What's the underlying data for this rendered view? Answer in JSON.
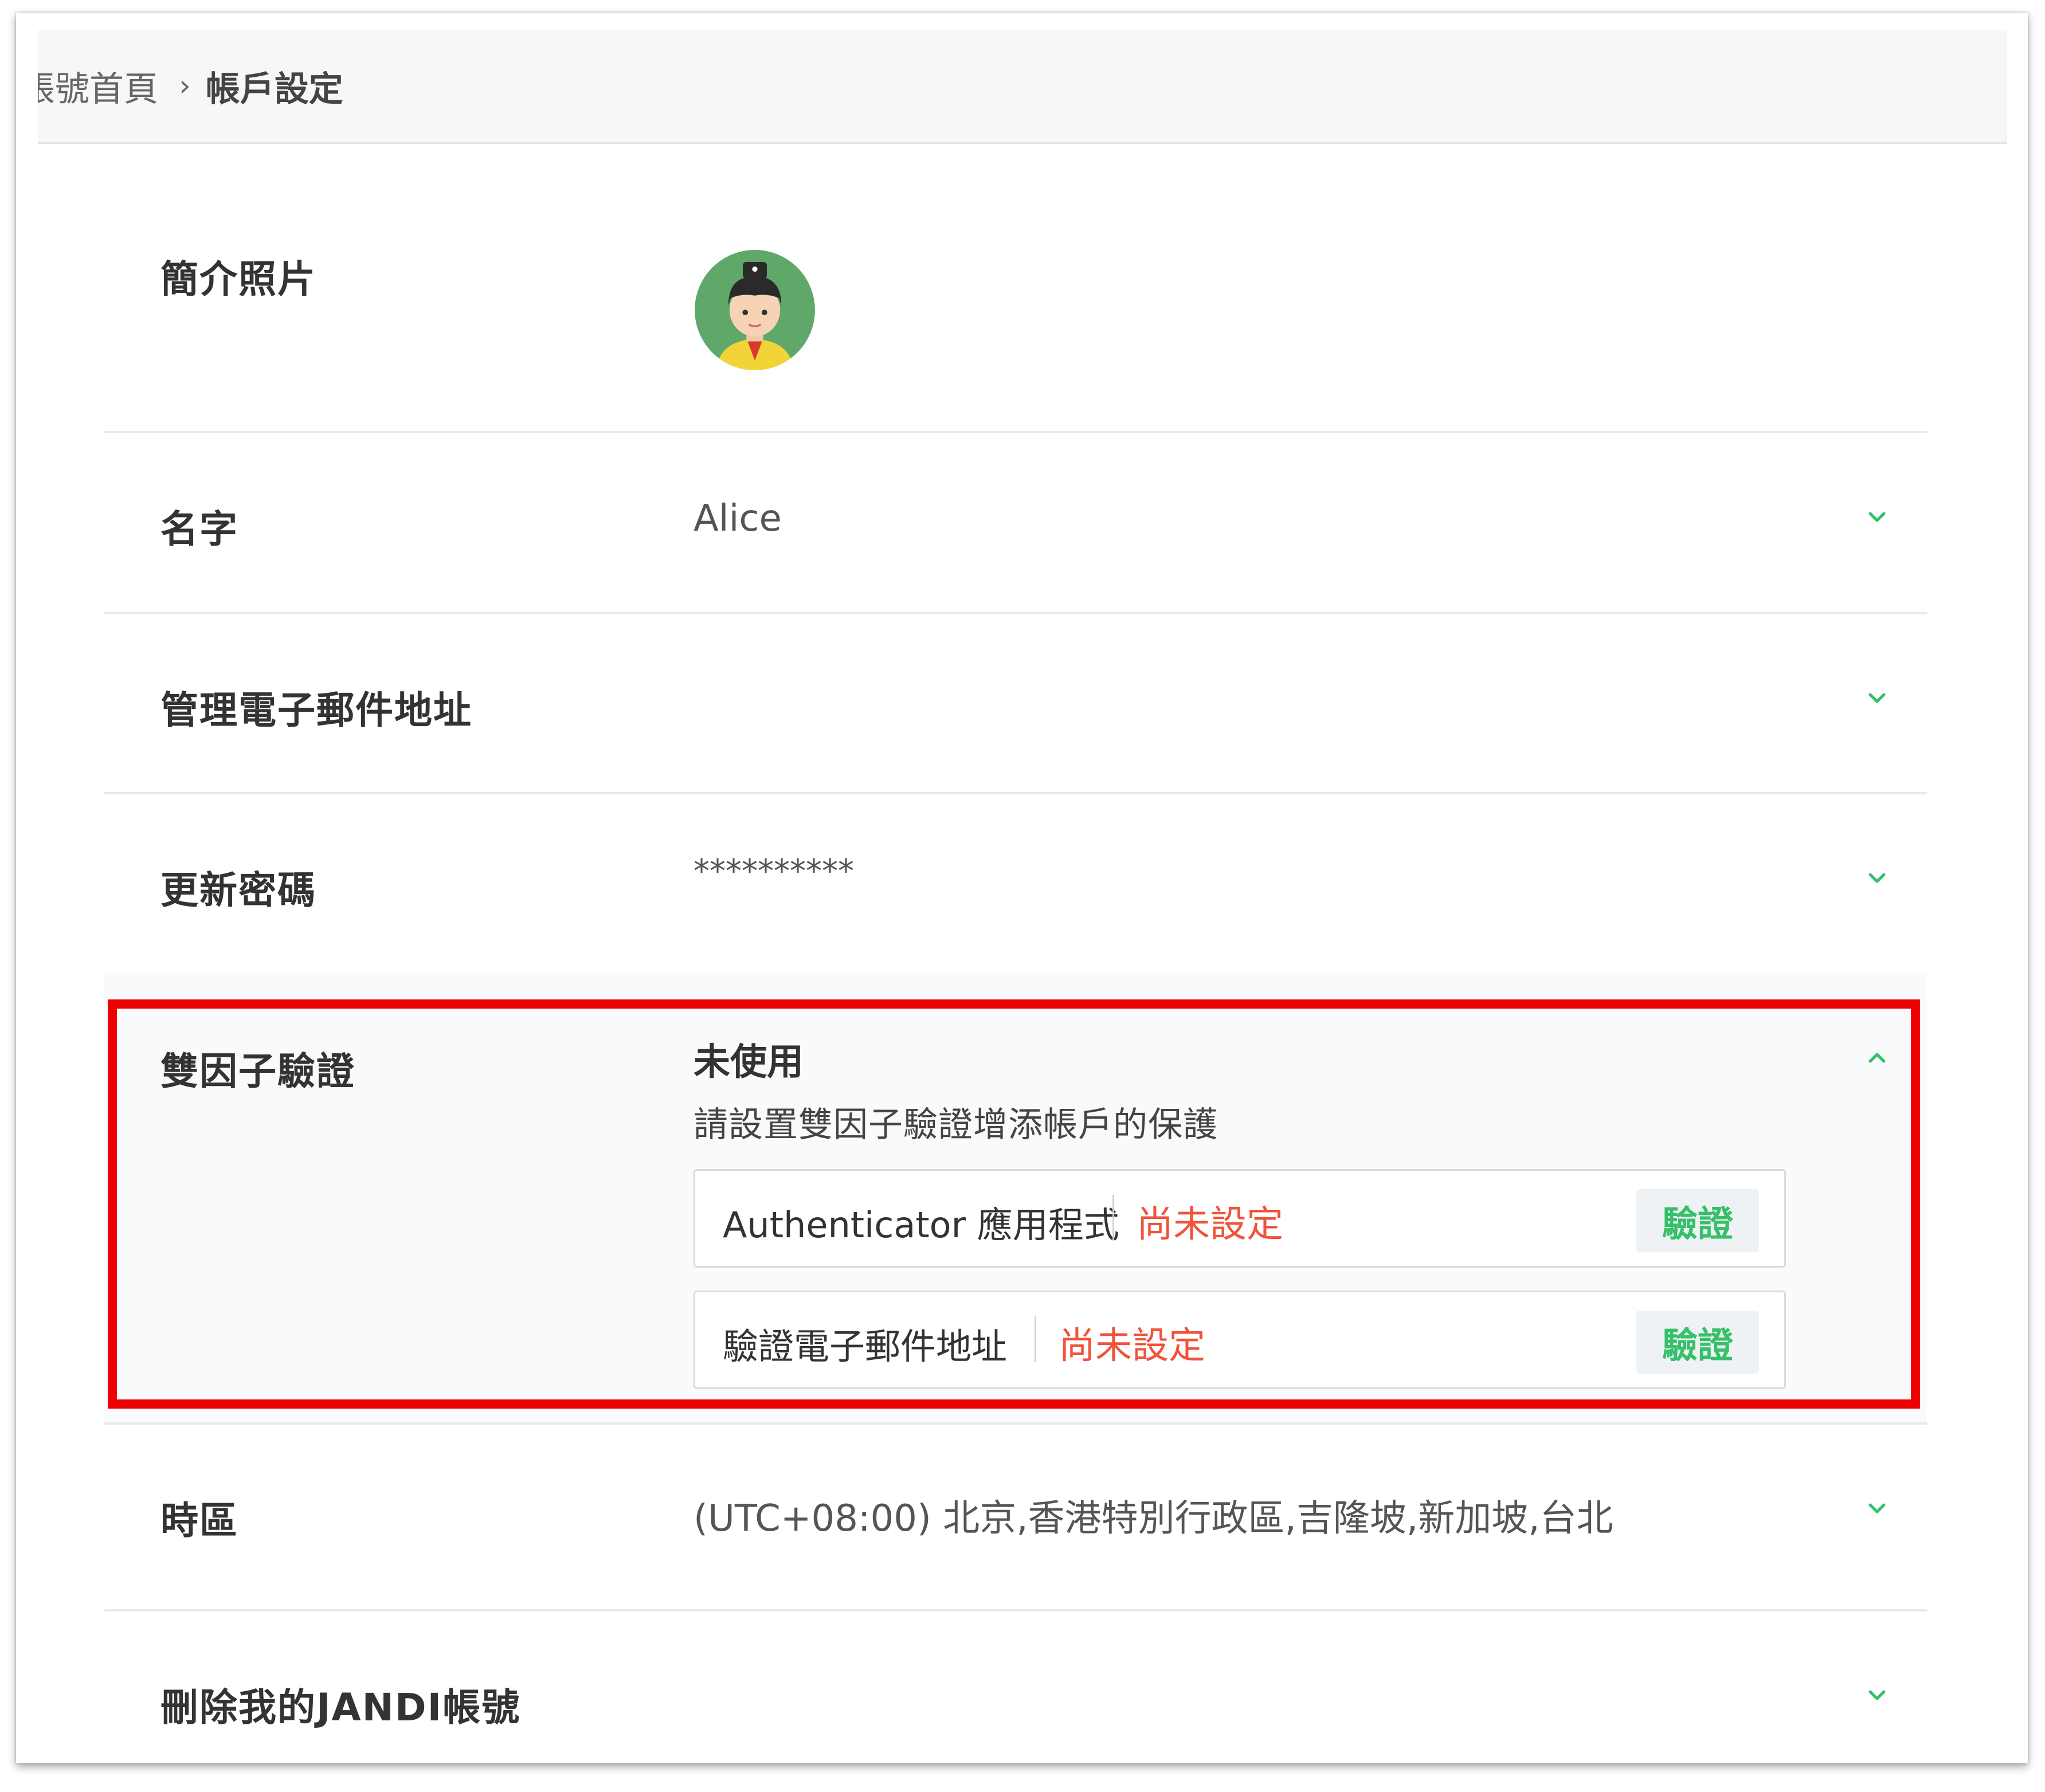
{
  "breadcrumb": {
    "home": "帳號首頁",
    "separator": "›",
    "current": "帳戶設定"
  },
  "rows": {
    "profile_photo": {
      "label": "簡介照片"
    },
    "name": {
      "label": "名字",
      "value": "Alice"
    },
    "admin_email": {
      "label": "管理電子郵件地址",
      "value": ""
    },
    "password": {
      "label": "更新密碼",
      "value": "**********"
    },
    "two_factor": {
      "label": "雙因子驗證",
      "status": "未使用",
      "description": "請設置雙因子驗證增添帳戶的保護",
      "methods": [
        {
          "name": "Authenticator 應用程式",
          "status": "尚未設定",
          "button": "驗證"
        },
        {
          "name": "驗證電子郵件地址",
          "status": "尚未設定",
          "button": "驗證"
        }
      ]
    },
    "timezone": {
      "label": "時區",
      "value": "(UTC+08:00) 北京,香港特別行政區,吉隆坡,新加坡,台北"
    },
    "delete_account": {
      "label": "刪除我的JANDI帳號"
    }
  },
  "icons": {
    "expand": "chevron-down-icon",
    "collapse": "chevron-up-icon"
  },
  "colors": {
    "accent": "#36c06a",
    "warning": "#f0523a",
    "highlight": "#ee0000"
  }
}
